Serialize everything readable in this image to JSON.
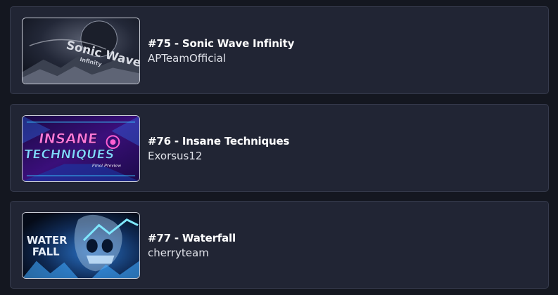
{
  "levels": [
    {
      "title": "#75 - Sonic Wave Infinity",
      "creator": "APTeamOfficial",
      "thumbnail": {
        "art_text": "Sonic Wave",
        "sub_text": "Infinity",
        "palette": [
          "#0f1320",
          "#5b6172",
          "#c8ccd6"
        ]
      }
    },
    {
      "title": "#76 - Insane Techniques",
      "creator": "Exorsus12",
      "thumbnail": {
        "art_text_1": "INSANE",
        "art_text_2": "TECHNIQUES",
        "sub_text": "Final Preview",
        "palette": [
          "#2a0b5e",
          "#b02ad8",
          "#37c7ff"
        ]
      }
    },
    {
      "title": "#77 - Waterfall",
      "creator": "cherryteam",
      "thumbnail": {
        "art_text_1": "WATER",
        "art_text_2": "FALL",
        "palette": [
          "#07162e",
          "#2a74c9",
          "#7fe8ff"
        ]
      }
    }
  ]
}
